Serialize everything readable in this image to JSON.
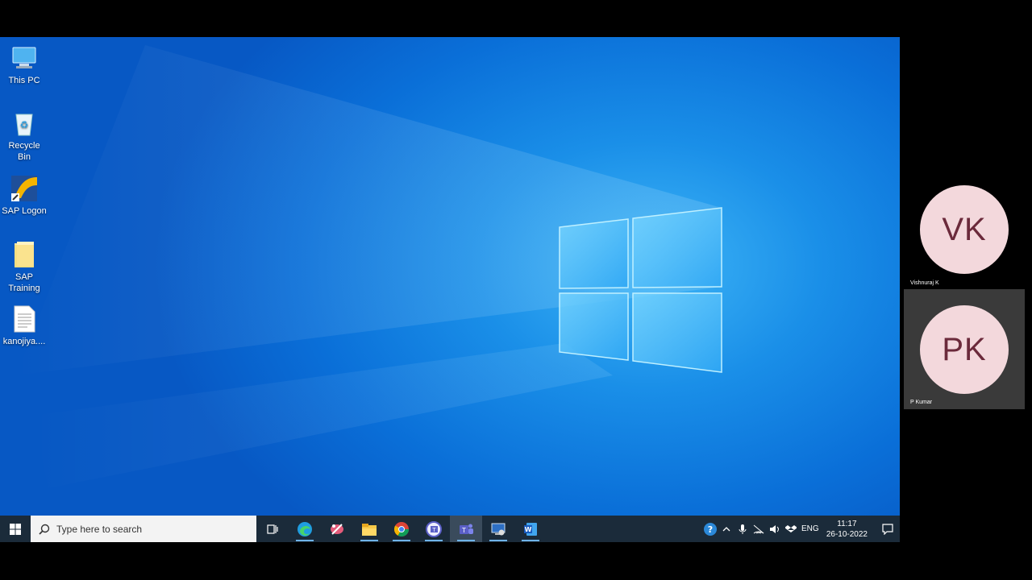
{
  "desktop": {
    "icons": [
      {
        "label": "This PC",
        "icon": "computer-icon"
      },
      {
        "label": "Recycle Bin",
        "icon": "recycle-bin-icon"
      },
      {
        "label": "SAP Logon",
        "icon": "sap-logon-icon"
      },
      {
        "label": "SAP Training",
        "icon": "folder-icon"
      },
      {
        "label": "kanojiya....",
        "icon": "document-icon"
      }
    ]
  },
  "taskbar": {
    "search_placeholder": "Type here to search",
    "apps": [
      "task-view",
      "edge",
      "snipping-tool",
      "file-explorer",
      "chrome",
      "teams-classic",
      "teams",
      "remote-desktop",
      "word"
    ],
    "tray": {
      "language": "ENG",
      "time": "11:17",
      "date": "26-10-2022"
    }
  },
  "participants": [
    {
      "initials": "VK",
      "name": "Vishnuraj K"
    },
    {
      "initials": "PK",
      "name": "P Kumar"
    }
  ],
  "colors": {
    "desktop_blue": "#0a6fd8",
    "taskbar": "#1b2b3a",
    "avatar_bg": "#f3d8dc",
    "avatar_text": "#6b2a3b"
  }
}
